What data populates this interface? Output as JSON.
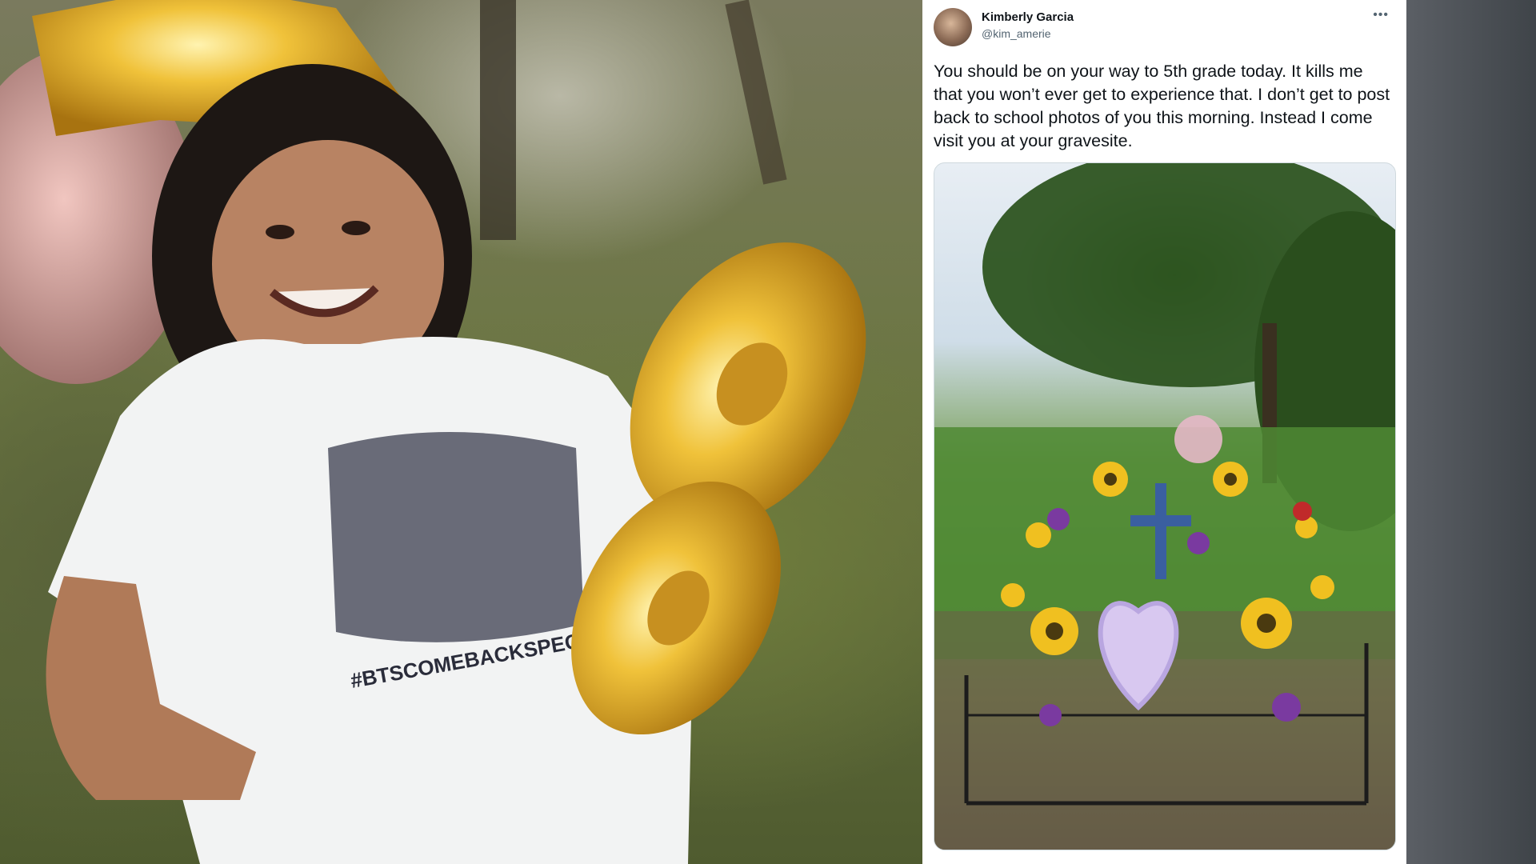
{
  "tweet": {
    "display_name": "Kimberly Garcia",
    "handle": "@kim_amerie",
    "more_icon": "more-horizontal-icon",
    "more_glyph": "•••",
    "text": "You should be on your way to 5th grade today. It kills me that you won’t ever get to experience that. I don’t get to post back to school photos of you this morning. Instead I come visit you at your gravesite."
  },
  "photo": {
    "shirt_text": "#BTSCOMEBACKSPECIAL"
  }
}
